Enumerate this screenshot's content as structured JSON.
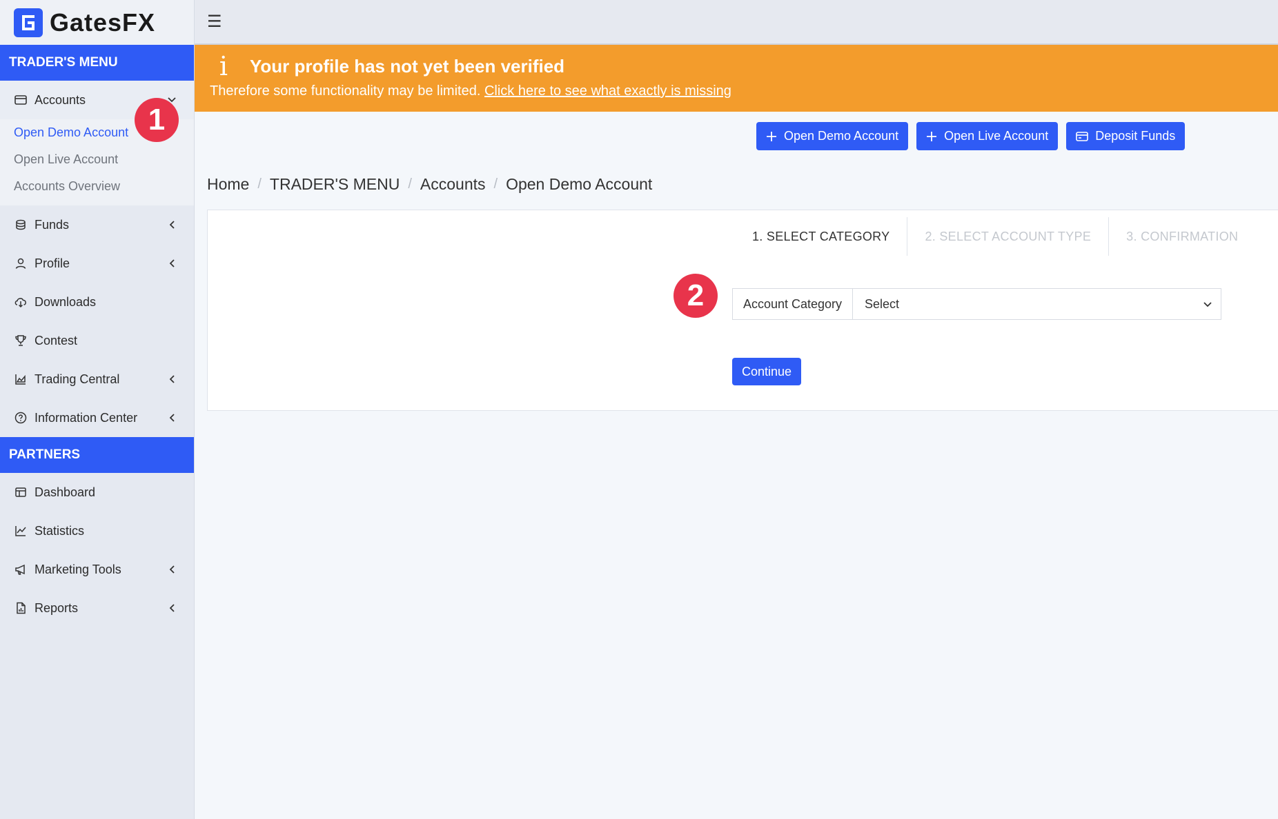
{
  "brand": {
    "name": "GatesFX"
  },
  "sidebar": {
    "traders_menu_header": "TRADER'S MENU",
    "accounts": {
      "label": "Accounts",
      "submenu": [
        "Open Demo Account",
        "Open Live Account",
        "Accounts Overview"
      ]
    },
    "traders_items": [
      {
        "label": "Funds",
        "icon": "coins-icon",
        "has_chevron": true
      },
      {
        "label": "Profile",
        "icon": "user-icon",
        "has_chevron": true
      },
      {
        "label": "Downloads",
        "icon": "cloud-download-icon",
        "has_chevron": false
      },
      {
        "label": "Contest",
        "icon": "trophy-icon",
        "has_chevron": false
      },
      {
        "label": "Trading Central",
        "icon": "area-chart-icon",
        "has_chevron": true
      },
      {
        "label": "Information Center",
        "icon": "question-circle-icon",
        "has_chevron": true
      }
    ],
    "partners_header": "PARTNERS",
    "partners_items": [
      {
        "label": "Dashboard",
        "icon": "layout-icon",
        "has_chevron": false
      },
      {
        "label": "Statistics",
        "icon": "line-chart-icon",
        "has_chevron": false
      },
      {
        "label": "Marketing Tools",
        "icon": "megaphone-icon",
        "has_chevron": true
      },
      {
        "label": "Reports",
        "icon": "file-chart-icon",
        "has_chevron": true
      }
    ]
  },
  "annotations": {
    "badge1": "1",
    "badge2": "2"
  },
  "topbar": {
    "menu_icon": "hamburger-icon"
  },
  "alert": {
    "title": "Your profile has not yet been verified",
    "message": "Therefore some functionality may be limited.",
    "link": "Click here to see what exactly is missing"
  },
  "actions": {
    "open_demo": "Open Demo Account",
    "open_live": "Open Live Account",
    "deposit": "Deposit Funds"
  },
  "breadcrumb": [
    "Home",
    "TRADER'S MENU",
    "Accounts",
    "Open Demo Account"
  ],
  "wizard": {
    "steps": [
      "1. SELECT CATEGORY",
      "2. SELECT ACCOUNT TYPE",
      "3. CONFIRMATION"
    ],
    "field_label": "Account Category",
    "select_value": "Select",
    "continue_label": "Continue"
  },
  "colors": {
    "primary": "#2f5bf5",
    "alert": "#f39c2c",
    "badge": "#e8344b"
  }
}
